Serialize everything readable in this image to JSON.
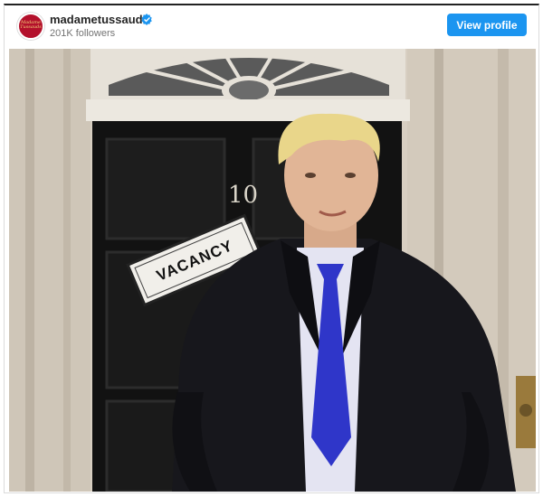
{
  "post": {
    "account": {
      "username": "madametussauds",
      "followers": "201K followers",
      "avatar_text": "Madame Tussauds",
      "verified": true
    },
    "actions": {
      "view_profile_label": "View profile"
    }
  },
  "photo": {
    "door_number": "10",
    "sign_text": "VACANCY"
  },
  "colors": {
    "accent": "#1b95f0",
    "avatar_bg": "#b3102b",
    "tie": "#2f36c9"
  },
  "icons": [
    "verified-badge-icon"
  ]
}
